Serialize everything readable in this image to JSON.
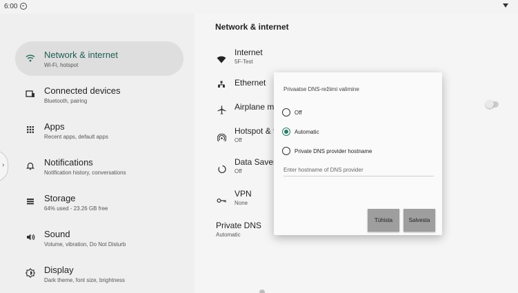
{
  "status_bar": {
    "time": "6:00"
  },
  "sidebar": {
    "items": [
      {
        "title": "Network & internet",
        "subtitle": "Wi-Fi, hotspot",
        "icon": "wifi-icon",
        "selected": true
      },
      {
        "title": "Connected devices",
        "subtitle": "Bluetooth, pairing",
        "icon": "devices-icon"
      },
      {
        "title": "Apps",
        "subtitle": "Recent apps, default apps",
        "icon": "apps-grid-icon"
      },
      {
        "title": "Notifications",
        "subtitle": "Notification history, conversations",
        "icon": "bell-icon"
      },
      {
        "title": "Storage",
        "subtitle": "64% used - 23.26 GB free",
        "icon": "storage-icon"
      },
      {
        "title": "Sound",
        "subtitle": "Volume, vibration, Do Not Disturb",
        "icon": "volume-icon"
      },
      {
        "title": "Display",
        "subtitle": "Dark theme, font size, brightness",
        "icon": "brightness-icon"
      }
    ]
  },
  "main": {
    "title": "Network & internet",
    "rows": [
      {
        "title": "Internet",
        "subtitle": "5F-Test",
        "icon": "wifi-filled-icon"
      },
      {
        "title": "Ethernet",
        "subtitle": "",
        "icon": "ethernet-icon"
      },
      {
        "title": "Airplane m",
        "subtitle": "",
        "icon": "airplane-icon"
      },
      {
        "title": "Hotspot & t",
        "subtitle": "Off",
        "icon": "hotspot-icon"
      },
      {
        "title": "Data Saver",
        "subtitle": "Off",
        "icon": "data-saver-icon"
      },
      {
        "title": "VPN",
        "subtitle": "None",
        "icon": "vpn-key-icon"
      },
      {
        "title": "Private DNS",
        "subtitle": "Automatic",
        "icon": ""
      }
    ]
  },
  "dialog": {
    "title": "Privaatse DNS-režiimi valimine",
    "options": [
      {
        "label": "Off",
        "checked": false
      },
      {
        "label": "Automatic",
        "checked": true
      },
      {
        "label": "Private DNS provider hostname",
        "checked": false
      }
    ],
    "hostname_placeholder": "Enter hostname of DNS provider",
    "hostname_value": "",
    "cancel_label": "Tühista",
    "save_label": "Salvesta"
  },
  "colors": {
    "accent": "#2a7a68",
    "selected_bg": "#dedede",
    "button_bg": "#9e9e9e"
  }
}
